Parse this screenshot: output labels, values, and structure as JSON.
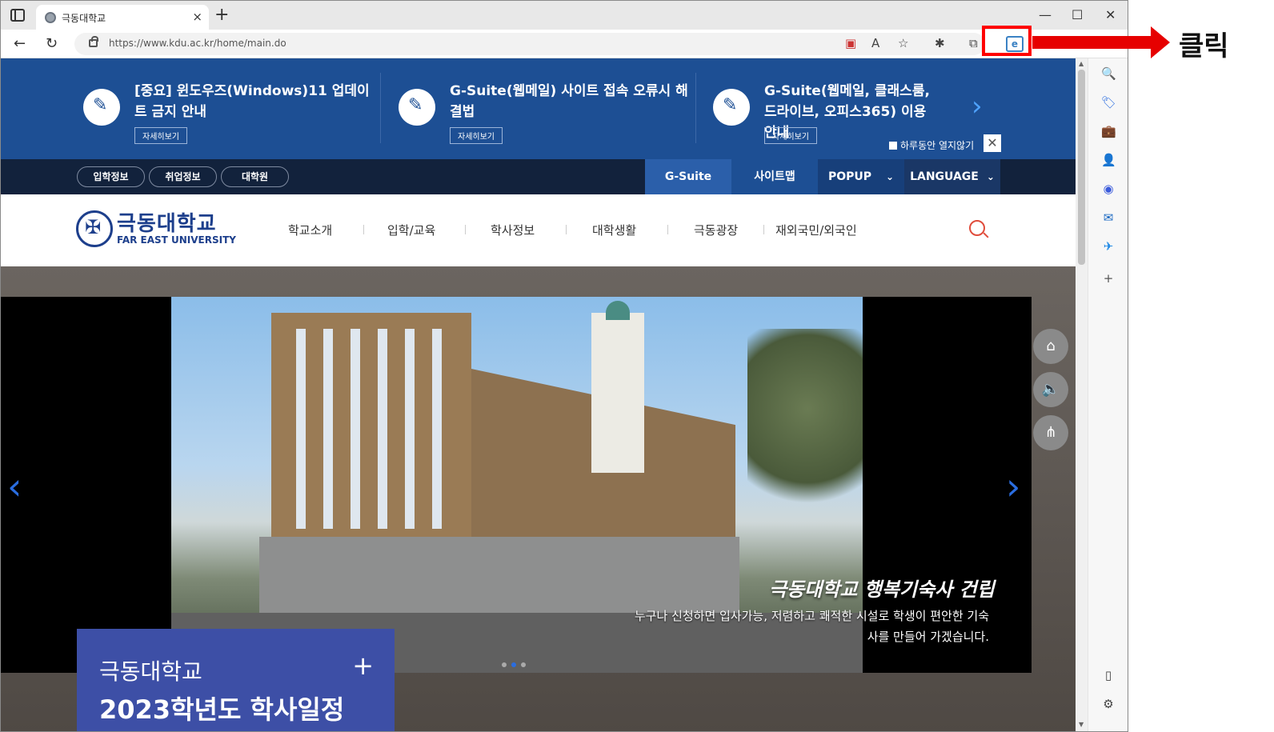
{
  "browser": {
    "tab_title": "극동대학교",
    "tab_close": "×",
    "new_tab": "+",
    "minimize": "—",
    "maximize": "☐",
    "close": "✕",
    "back": "←",
    "reload": "↻",
    "url": "https://www.kdu.ac.kr/home/main.do",
    "ie_mode_label": "e"
  },
  "notice": {
    "items": [
      {
        "title": "[중요] 윈도우즈(Windows)11 업데이트 금지 안내",
        "more": "자세히보기"
      },
      {
        "title": "G-Suite(웹메일) 사이트 접속 오류시 해결법",
        "more": "자세히보기"
      },
      {
        "title": "G-Suite(웹메일, 클래스룸, 드라이브, 오피스365) 이용 안내",
        "more": "자세히보기"
      }
    ],
    "next": "›",
    "dont_show": "하루동안 열지않기",
    "close": "✕"
  },
  "util": {
    "pills": [
      "입학정보",
      "취업정보",
      "대학원"
    ],
    "gsuite": "G-Suite",
    "sitemap": "사이트맵",
    "popup": "POPUP",
    "language": "LANGUAGE",
    "chevron": "⌄"
  },
  "header": {
    "logo_kr": "극동대학교",
    "logo_en": "FAR EAST UNIVERSITY",
    "menu": [
      "학교소개",
      "입학/교육",
      "학사정보",
      "대학생활",
      "극동광장",
      "재외국민/외국인"
    ]
  },
  "hero": {
    "caption_title": "극동대학교 행복기숙사 건립",
    "caption_desc": "누구나 신청하면 입사가능, 저렴하고 쾌적한 시설로 학생이 편안한 기숙사를 만들어 가겠습니다.",
    "prev": "‹",
    "next": "›",
    "home_btn": "⌂",
    "sound_btn": "🔈",
    "share_btn": "⋔"
  },
  "schedule": {
    "sub": "극동대학교",
    "title": "2023학년도 학사일정",
    "plus": "+"
  },
  "annotation": {
    "label": "클릭"
  },
  "sidebar": {
    "icons": [
      "🔍",
      "🏷",
      "💼",
      "👤",
      "◉",
      "✉",
      "✈",
      "+"
    ],
    "bottom_icons": [
      "▯",
      "⚙"
    ]
  },
  "colors": {
    "notice_bg": "#1d4f94",
    "util_bg": "#12223c",
    "brand": "#1d3f8c",
    "highlight": "#ff0000"
  }
}
